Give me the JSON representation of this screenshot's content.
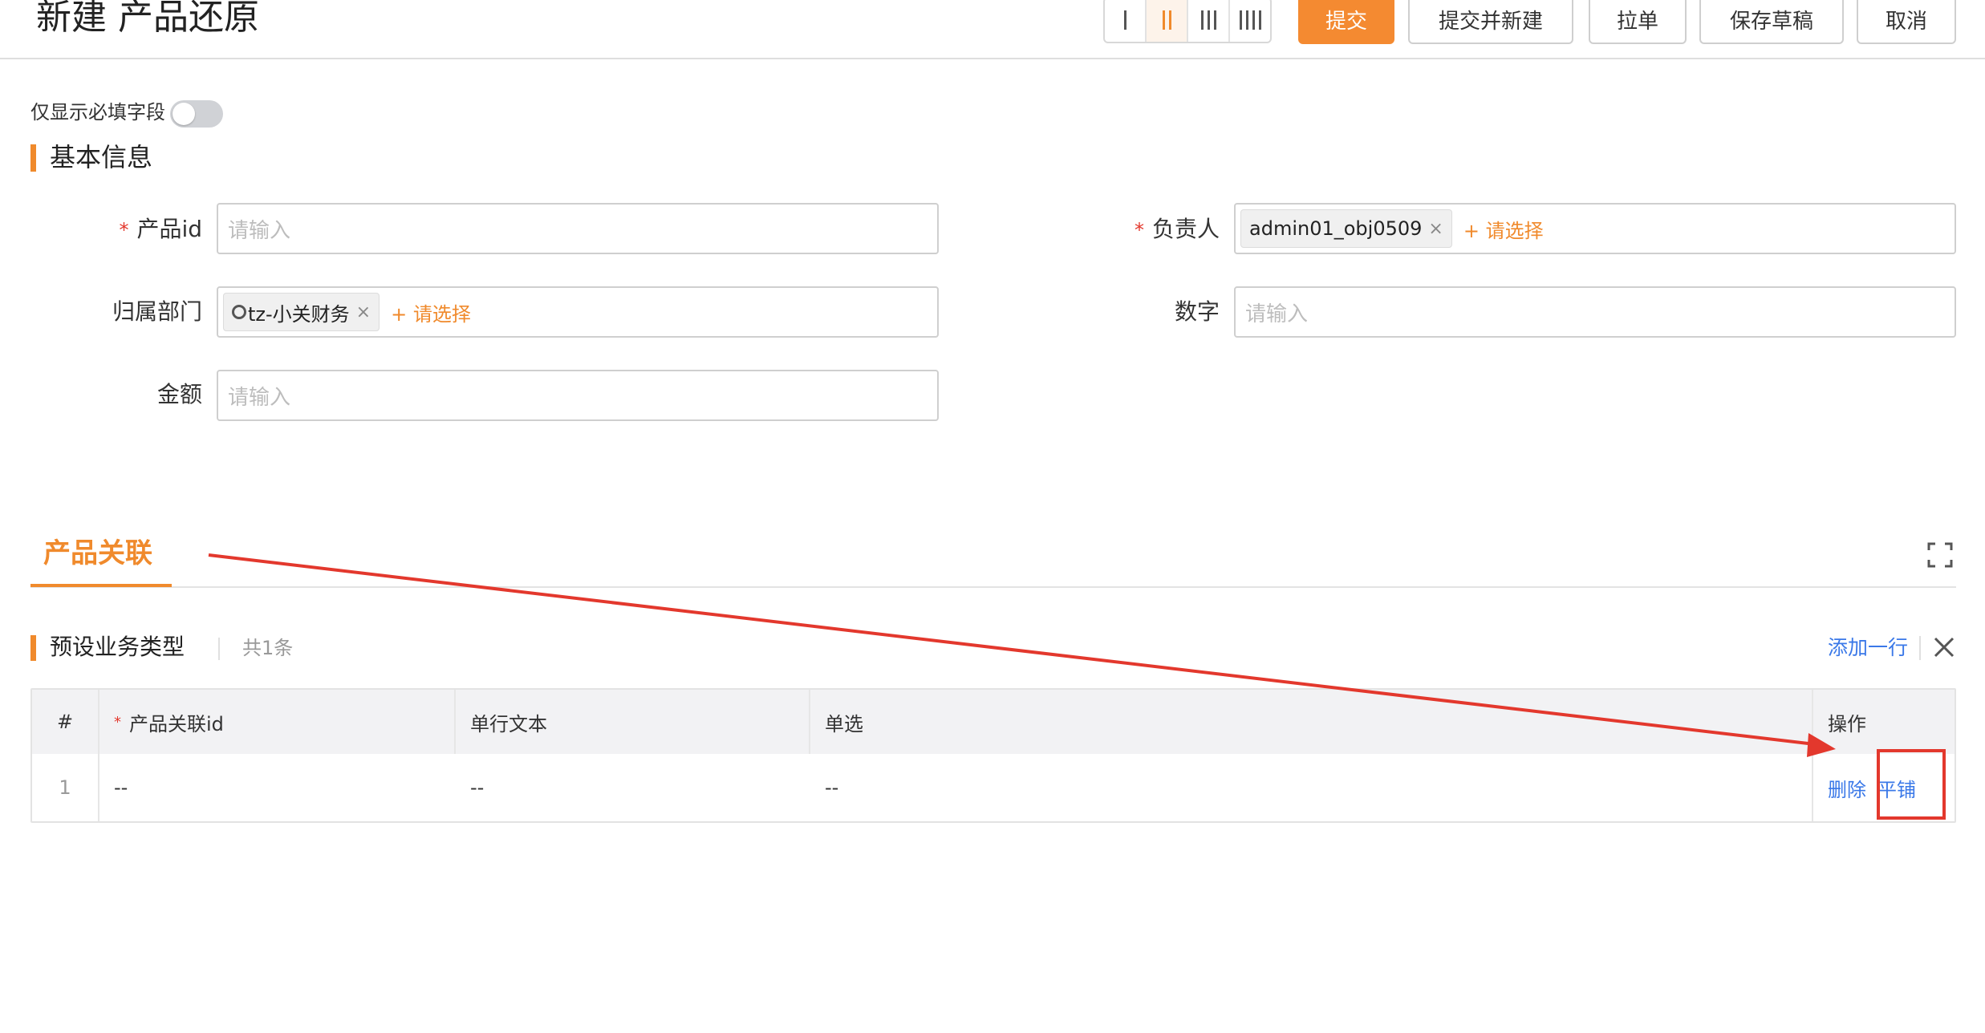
{
  "header": {
    "title": "新建 产品还原",
    "column_switch": [
      "I",
      "II",
      "III",
      "IIII"
    ],
    "column_switch_active": "II",
    "buttons": {
      "submit": "提交",
      "submit_and_new": "提交并新建",
      "pull_order": "拉单",
      "save_draft": "保存草稿",
      "cancel": "取消"
    }
  },
  "required_only": {
    "label": "仅显示必填字段",
    "enabled": false
  },
  "basic_info": {
    "title": "基本信息",
    "fields": {
      "product_id": {
        "label": "产品id",
        "required": true,
        "placeholder": "请输入"
      },
      "owner": {
        "label": "负责人",
        "required": true,
        "tag": "admin01_obj0509",
        "add_label": "+ 请选择"
      },
      "department": {
        "label": "归属部门",
        "required": false,
        "tag": "tz-小关财务",
        "add_label": "+ 请选择"
      },
      "number": {
        "label": "数字",
        "required": false,
        "placeholder": "请输入"
      },
      "amount": {
        "label": "金额",
        "required": false,
        "placeholder": "请输入"
      }
    }
  },
  "related": {
    "tab_label": "产品关联",
    "subsection": {
      "title": "预设业务类型",
      "count": "共1条",
      "add_row": "添加一行",
      "columns": [
        "#",
        "产品关联id",
        "单行文本",
        "单选",
        "操作"
      ],
      "rows": [
        {
          "index": "1",
          "product_related_id": "--",
          "text": "--",
          "single_select": "--",
          "actions": [
            "删除",
            "平铺"
          ]
        }
      ]
    }
  },
  "colors": {
    "accent": "#f08a2c",
    "link": "#3a78e8",
    "required": "#e3382d",
    "annotation": "#e3382d"
  }
}
